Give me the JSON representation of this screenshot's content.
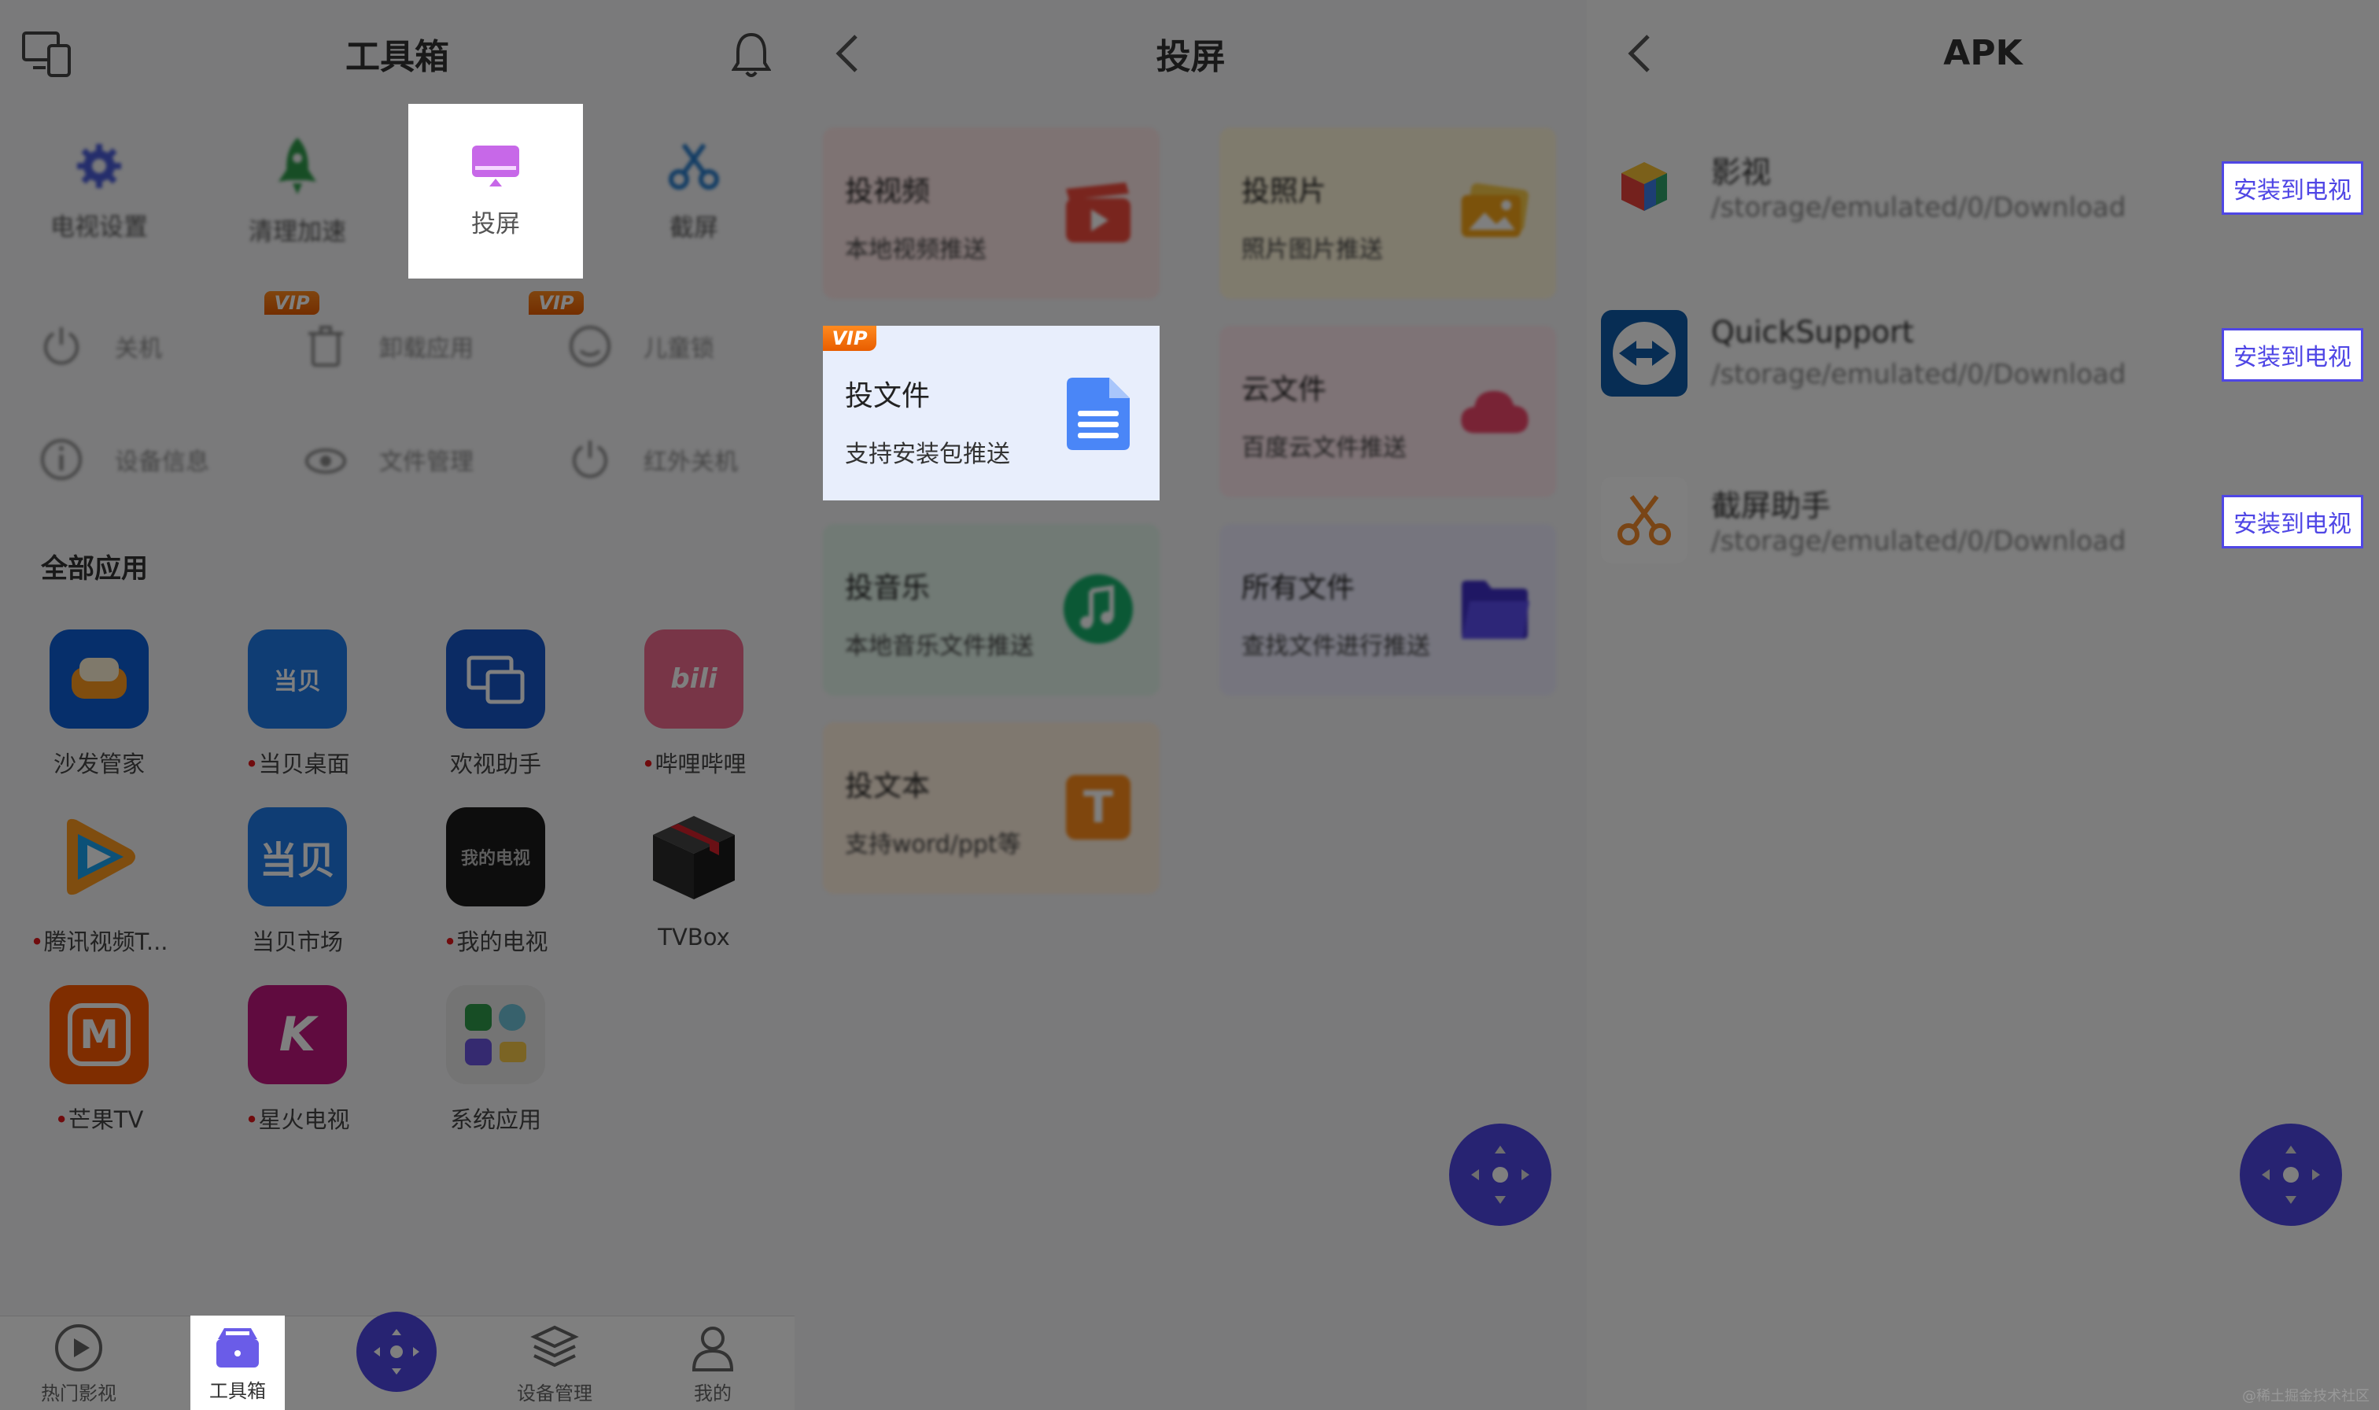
{
  "left": {
    "title": "工具箱",
    "tools": [
      {
        "label": "电视设置",
        "icon": "gear-icon"
      },
      {
        "label": "清理加速",
        "icon": "rocket-icon"
      },
      {
        "label": "投屏",
        "icon": "screen-cast-icon"
      },
      {
        "label": "截屏",
        "icon": "scissors-icon"
      }
    ],
    "quick": [
      {
        "label": "关机"
      },
      {
        "label": "卸载应用",
        "vip": "VIP"
      },
      {
        "label": "儿童锁",
        "vip": "VIP"
      },
      {
        "label": "设备信息"
      },
      {
        "label": "文件管理"
      },
      {
        "label": "红外关机"
      }
    ],
    "section_title": "全部应用",
    "apps": [
      {
        "label": "沙发管家",
        "dot": false,
        "color": "#0d5fd6",
        "glyph": ""
      },
      {
        "label": "当贝桌面",
        "dot": true,
        "color": "#1f7be8",
        "glyph": "当贝"
      },
      {
        "label": "欢视助手",
        "dot": false,
        "color": "#1757c9",
        "glyph": ""
      },
      {
        "label": "哔哩哔哩",
        "dot": true,
        "color": "#f06a8f",
        "glyph": "bili"
      },
      {
        "label": "腾讯视频T...",
        "dot": true,
        "color": "#ffffff",
        "glyph": ""
      },
      {
        "label": "当贝市场",
        "dot": false,
        "color": "#1f7be8",
        "glyph": "当贝"
      },
      {
        "label": "我的电视",
        "dot": true,
        "color": "#1b1b1b",
        "glyph": "我的电视"
      },
      {
        "label": "TVBox",
        "dot": false,
        "color": "#333333",
        "glyph": ""
      },
      {
        "label": "芒果TV",
        "dot": true,
        "color": "#ff5a00",
        "glyph": "M"
      },
      {
        "label": "星火电视",
        "dot": true,
        "color": "#c0177f",
        "glyph": "K"
      },
      {
        "label": "系统应用",
        "dot": false,
        "color": "#e8e8e8",
        "glyph": ""
      }
    ],
    "nav": [
      {
        "label": "热门影视"
      },
      {
        "label": "工具箱"
      },
      {
        "label": ""
      },
      {
        "label": "设备管理"
      },
      {
        "label": "我的"
      }
    ]
  },
  "middle": {
    "title": "投屏",
    "cards": [
      {
        "title": "投视频",
        "sub": "本地视频推送",
        "bg": "#fde6e6",
        "icon_color": "#f24b3d"
      },
      {
        "title": "投照片",
        "sub": "照片图片推送",
        "bg": "#fff6db",
        "icon_color": "#f7a416"
      },
      {
        "title": "投文件",
        "sub": "支持安装包推送",
        "bg": "#e8eefc",
        "icon_color": "#4a86f7",
        "vip": "VIP"
      },
      {
        "title": "云文件",
        "sub": "百度云文件推送",
        "bg": "#fde6ec",
        "icon_color": "#f0466a"
      },
      {
        "title": "投音乐",
        "sub": "本地音乐文件推送",
        "bg": "#e2f4ea",
        "icon_color": "#16b06b"
      },
      {
        "title": "所有文件",
        "sub": "查找文件进行推送",
        "bg": "#ecebfd",
        "icon_color": "#5b4cf0"
      },
      {
        "title": "投文本",
        "sub": "支持word/ppt等",
        "bg": "#fff0df",
        "icon_color": "#ff8c1a",
        "glyph": "T"
      }
    ]
  },
  "right": {
    "title": "APK",
    "items": [
      {
        "name": "影视",
        "path": "/storage/emulated/0/Download",
        "button": "安装到电视"
      },
      {
        "name": "QuickSupport",
        "path": "/storage/emulated/0/Download",
        "button": "安装到电视"
      },
      {
        "name": "截屏助手",
        "path": "/storage/emulated/0/Download",
        "button": "安装到电视"
      }
    ]
  },
  "watermark": "@稀土掘金技术社区"
}
